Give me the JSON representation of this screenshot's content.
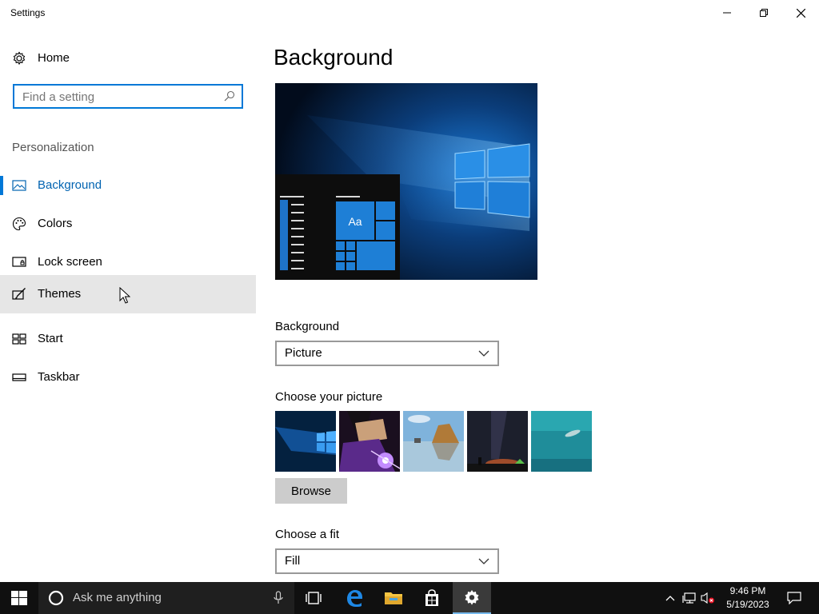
{
  "window": {
    "title": "Settings"
  },
  "sidebar": {
    "home_label": "Home",
    "search_placeholder": "Find a setting",
    "section_header": "Personalization",
    "items": [
      {
        "label": "Background",
        "icon": "picture-icon",
        "selected": true
      },
      {
        "label": "Colors",
        "icon": "palette-icon"
      },
      {
        "label": "Lock screen",
        "icon": "lock-screen-icon"
      },
      {
        "label": "Themes",
        "icon": "brush-icon",
        "hover": true
      },
      {
        "label": "Start",
        "icon": "start-tiles-icon"
      },
      {
        "label": "Taskbar",
        "icon": "taskbar-icon"
      }
    ]
  },
  "main": {
    "title": "Background",
    "preview_tile_text": "Aa",
    "background_label": "Background",
    "background_value": "Picture",
    "choose_picture_label": "Choose your picture",
    "browse_label": "Browse",
    "choose_fit_label": "Choose a fit",
    "fit_value": "Fill"
  },
  "taskbar": {
    "search_text": "Ask me anything",
    "time": "9:46 PM",
    "date": "5/19/2023"
  },
  "colors": {
    "accent": "#0078d7",
    "selected_text": "#0063b1",
    "hover_bg": "#e6e6e6",
    "taskbar_bg": "#101010"
  }
}
